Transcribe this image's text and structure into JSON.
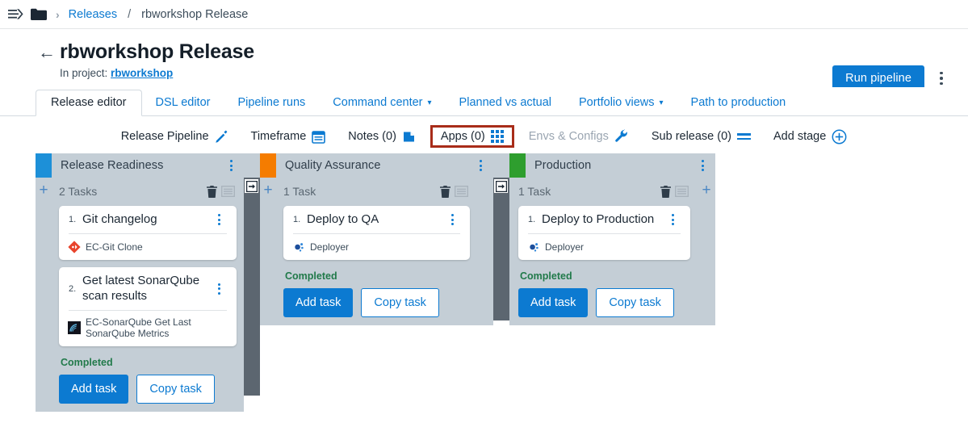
{
  "topbar": {
    "menu_icon": "hamburger-arrow-icon",
    "folder_icon": "folder-icon",
    "chevron": "›",
    "breadcrumb_link": "Releases",
    "breadcrumb_slash": "/",
    "breadcrumb_current": "rbworkshop Release"
  },
  "header": {
    "back_icon": "←",
    "title": "rbworkshop Release",
    "subtitle_prefix": "In project: ",
    "project_name": "rbworkshop",
    "run_pipeline_label": "Run pipeline",
    "more_icon": "kebab-menu-icon"
  },
  "tabs": [
    {
      "label": "Release editor",
      "active": true,
      "dropdown": false
    },
    {
      "label": "DSL editor",
      "active": false,
      "dropdown": false
    },
    {
      "label": "Pipeline runs",
      "active": false,
      "dropdown": false
    },
    {
      "label": "Command center",
      "active": false,
      "dropdown": true
    },
    {
      "label": "Planned vs actual",
      "active": false,
      "dropdown": false
    },
    {
      "label": "Portfolio views",
      "active": false,
      "dropdown": true
    },
    {
      "label": "Path to production",
      "active": false,
      "dropdown": false
    }
  ],
  "toolbar": [
    {
      "label": "Release Pipeline",
      "icon": "pencil-icon",
      "state": "normal"
    },
    {
      "label": "Timeframe",
      "icon": "calendar-icon",
      "state": "normal"
    },
    {
      "label": "Notes (0)",
      "icon": "note-page-icon",
      "state": "normal"
    },
    {
      "label": "Apps (0)",
      "icon": "apps-grid-icon",
      "state": "highlighted"
    },
    {
      "label": "Envs & Configs",
      "icon": "wrench-icon",
      "state": "disabled"
    },
    {
      "label": "Sub release (0)",
      "icon": "lines-icon",
      "state": "normal"
    },
    {
      "label": "Add stage",
      "icon": "plus-circle-icon",
      "state": "normal"
    }
  ],
  "colors": {
    "accent_blue": "#0c7ad1",
    "highlight_red": "#a82c19",
    "stage_release_readiness": "#1d90d8",
    "stage_quality_assurance": "#f57c00",
    "stage_production": "#2e9e2e",
    "completed_green": "#217a4a",
    "board_bg": "#c4ced6",
    "gate_gray": "#5c6670"
  },
  "stages": [
    {
      "name": "Release Readiness",
      "color": "#1d90d8",
      "task_count_label": "2 Tasks",
      "status": "Completed",
      "add_task_label": "Add task",
      "copy_task_label": "Copy task",
      "has_left_plus": true,
      "has_gate_after": true,
      "tasks": [
        {
          "num": "1.",
          "title": "Git changelog",
          "plugin": "EC-Git Clone",
          "plugin_icon": "git-diamond-icon"
        },
        {
          "num": "2.",
          "title": "Get latest SonarQube scan results",
          "plugin": "EC-SonarQube Get Last SonarQube Metrics",
          "plugin_icon": "sonarqube-icon"
        }
      ]
    },
    {
      "name": "Quality Assurance",
      "color": "#f57c00",
      "task_count_label": "1 Task",
      "status": "Completed",
      "add_task_label": "Add task",
      "copy_task_label": "Copy task",
      "has_left_plus": true,
      "has_gate_after": true,
      "tasks": [
        {
          "num": "1.",
          "title": "Deploy to QA",
          "plugin": "Deployer",
          "plugin_icon": "deployer-dots-icon"
        }
      ]
    },
    {
      "name": "Production",
      "color": "#2e9e2e",
      "task_count_label": "1 Task",
      "status": "Completed",
      "add_task_label": "Add task",
      "copy_task_label": "Copy task",
      "has_left_plus": false,
      "has_gate_after": false,
      "tasks": [
        {
          "num": "1.",
          "title": "Deploy to Production",
          "plugin": "Deployer",
          "plugin_icon": "deployer-dots-icon"
        }
      ]
    }
  ],
  "trailing_plus": "+"
}
